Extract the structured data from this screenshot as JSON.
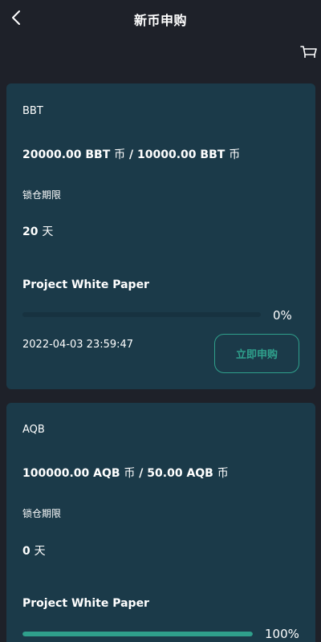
{
  "header": {
    "title": "新币申购",
    "back_icon": "chevron-left-icon",
    "cart_icon": "cart-icon"
  },
  "colors": {
    "background": "#1e2129",
    "card": "#1b3a49",
    "accent": "#2fa08c"
  },
  "cards": [
    {
      "symbol": "BBT",
      "amount_total": "20000.00 BBT",
      "amount_sep": " / ",
      "amount_available": "10000.00 BBT",
      "amount_unit": "币",
      "lock_label": "锁仓期限",
      "lock_days": "20",
      "lock_unit": "天",
      "white_paper": "Project White Paper",
      "progress": 0,
      "progress_text": "0%",
      "date": "2022-04-03 23:59:47",
      "button": "立即申购"
    },
    {
      "symbol": "AQB",
      "amount_total": "100000.00 AQB",
      "amount_sep": " / ",
      "amount_available": "50.00 AQB",
      "amount_unit": "币",
      "lock_label": "锁仓期限",
      "lock_days": "0",
      "lock_unit": "天",
      "white_paper": "Project White Paper",
      "progress": 100,
      "progress_text": "100%"
    }
  ]
}
